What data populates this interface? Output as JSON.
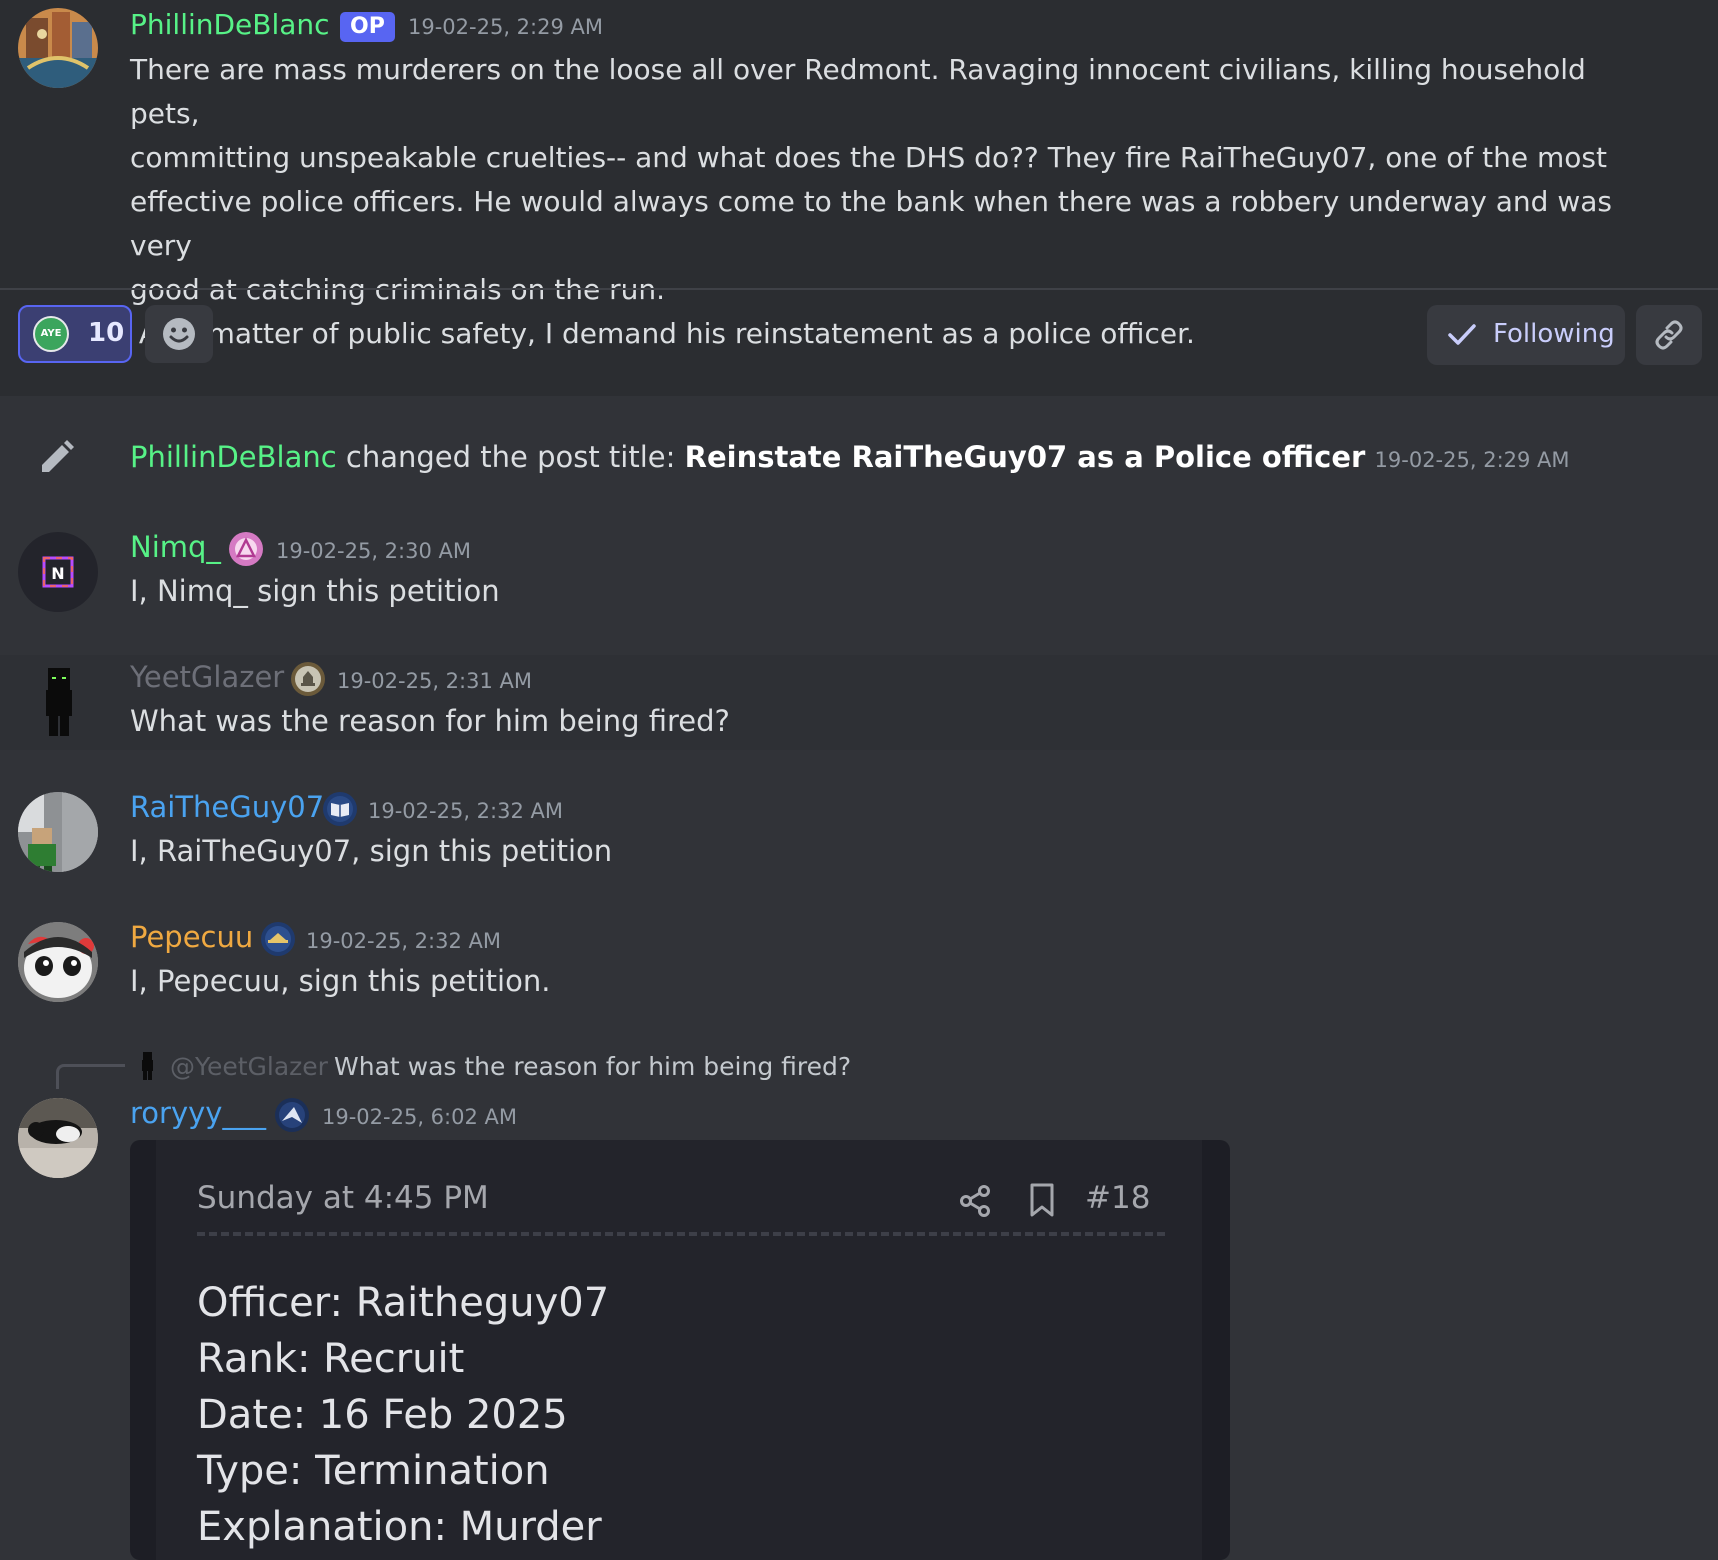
{
  "op": {
    "author": "PhillinDeBlanc",
    "badge": "OP",
    "timestamp": "19-02-25, 2:29 AM",
    "body_lines": [
      "There are mass murderers on the loose all over Redmont. Ravaging innocent civilians, killing household pets,",
      "committing unspeakable cruelties-- and what does the DHS do?? They fire RaiTheGuy07, one of the most",
      "effective police officers. He would always come to the bank when there was a robbery underway and was very",
      "good at catching criminals on the run.",
      " As a matter of public safety, I demand his reinstatement as a police officer."
    ]
  },
  "reactions": {
    "aye_icon_text": "AYE",
    "aye_count": "10",
    "follow_label": "Following"
  },
  "system_message": {
    "author": "PhillinDeBlanc",
    "action": " changed the post title: ",
    "new_title": "Reinstate RaiTheGuy07 as a Police officer",
    "timestamp": "19-02-25, 2:29 AM"
  },
  "messages": [
    {
      "author": "Nimq_",
      "timestamp": "19-02-25, 2:30 AM",
      "text": "I, Nimq_ sign this petition",
      "avatar_letter": "N"
    },
    {
      "author": "YeetGlazer",
      "timestamp": "19-02-25, 2:31 AM",
      "text": "What was the reason for him being fired?"
    },
    {
      "author": "RaiTheGuy07",
      "timestamp": "19-02-25, 2:32 AM",
      "text": "I, RaiTheGuy07, sign this petition"
    },
    {
      "author": "Pepecuu",
      "timestamp": "19-02-25, 2:32 AM",
      "text": "I, Pepecuu, sign this petition."
    },
    {
      "author": "roryyy___",
      "timestamp": "19-02-25, 6:02 AM",
      "reply_mention": "@YeetGlazer",
      "reply_text": "What was the reason for him being fired?"
    }
  ],
  "embed": {
    "date": "Sunday at 4:45 PM",
    "number": "#18",
    "lines": [
      "Officer: Raitheguy07",
      "Rank: Recruit",
      "Date: 16 Feb 2025",
      "Type: Termination",
      "Explanation: Murder"
    ]
  },
  "colors": {
    "background": "#313338",
    "op_background": "#2b2d31",
    "name_green": "#57f287",
    "name_blue": "#4aa3f0",
    "name_orange": "#f0a941",
    "name_gray": "#6d6f78",
    "accent": "#5865f2"
  }
}
